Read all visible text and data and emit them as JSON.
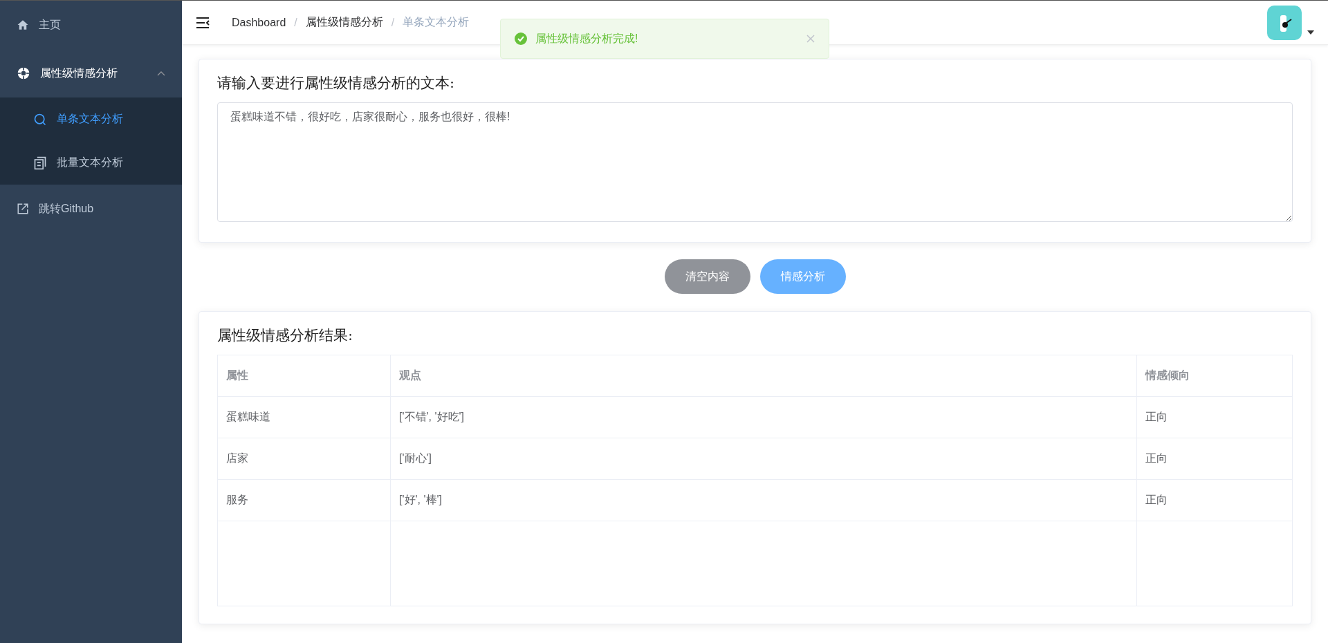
{
  "sidebar": {
    "items": [
      {
        "kind": "link",
        "label": "主页",
        "selected": false
      },
      {
        "kind": "group",
        "label": "属性级情感分析",
        "expanded": true,
        "children": [
          {
            "label": "单条文本分析",
            "selected": true
          },
          {
            "label": "批量文本分析",
            "selected": false
          }
        ]
      },
      {
        "kind": "link",
        "label": "跳转Github",
        "selected": false
      }
    ]
  },
  "header": {
    "separators": [
      "/",
      "/"
    ],
    "breadcrumb": [
      {
        "label": "Dashboard",
        "current": false
      },
      {
        "label": "属性级情感分析",
        "current": false
      },
      {
        "label": "单条文本分析",
        "current": true
      }
    ]
  },
  "toast": {
    "message": "属性级情感分析完成!"
  },
  "input_card": {
    "title": "请输入要进行属性级情感分析的文本:",
    "value": "蛋糕味道不错，很好吃，店家很耐心，服务也很好，很棒!"
  },
  "buttons": [
    {
      "kind": "secondary",
      "label": "清空内容"
    },
    {
      "kind": "primary",
      "label": "情感分析"
    }
  ],
  "result_card": {
    "title": "属性级情感分析结果:",
    "columns": [
      "属性",
      "观点",
      "情感倾向"
    ],
    "rows": [
      [
        "蛋糕味道",
        "['不错', '好吃']",
        "正向"
      ],
      [
        "店家",
        "['耐心']",
        "正向"
      ],
      [
        "服务",
        "['好', '棒']",
        "正向"
      ]
    ]
  }
}
